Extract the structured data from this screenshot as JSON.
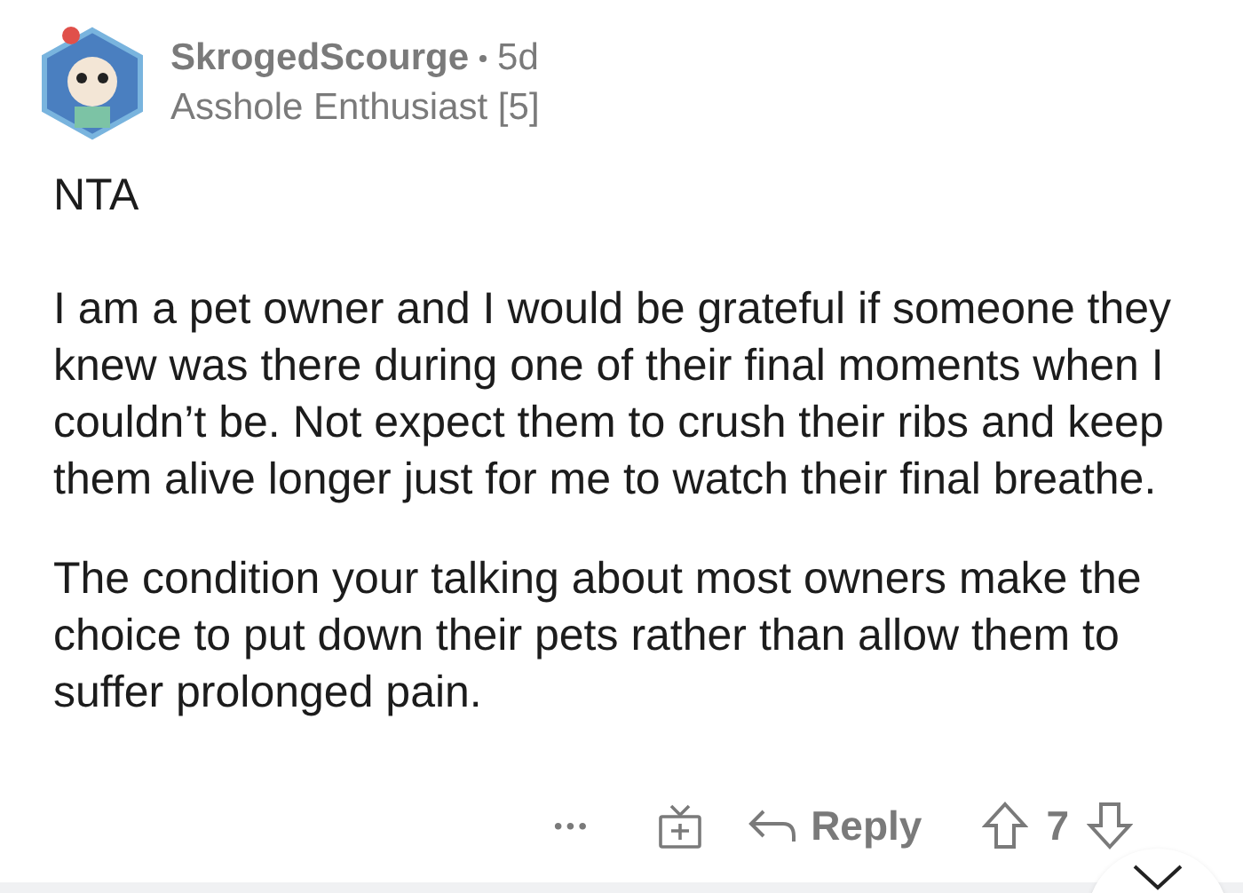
{
  "comment": {
    "author": "SkrogedScourge",
    "age": "5d",
    "flair": "Asshole Enthusiast [5]",
    "paragraphs": [
      "NTA",
      "I am a pet owner and I would be grateful if someone they knew was there during one of their final moments when I couldn’t be. Not expect them to crush their ribs and keep them alive longer just for me to watch their final breathe.",
      "The condition your talking about most owners make the choice to put down their pets rather than allow them to suffer prolonged pain."
    ]
  },
  "actions": {
    "more": "•••",
    "reply": "Reply",
    "score": "7"
  }
}
